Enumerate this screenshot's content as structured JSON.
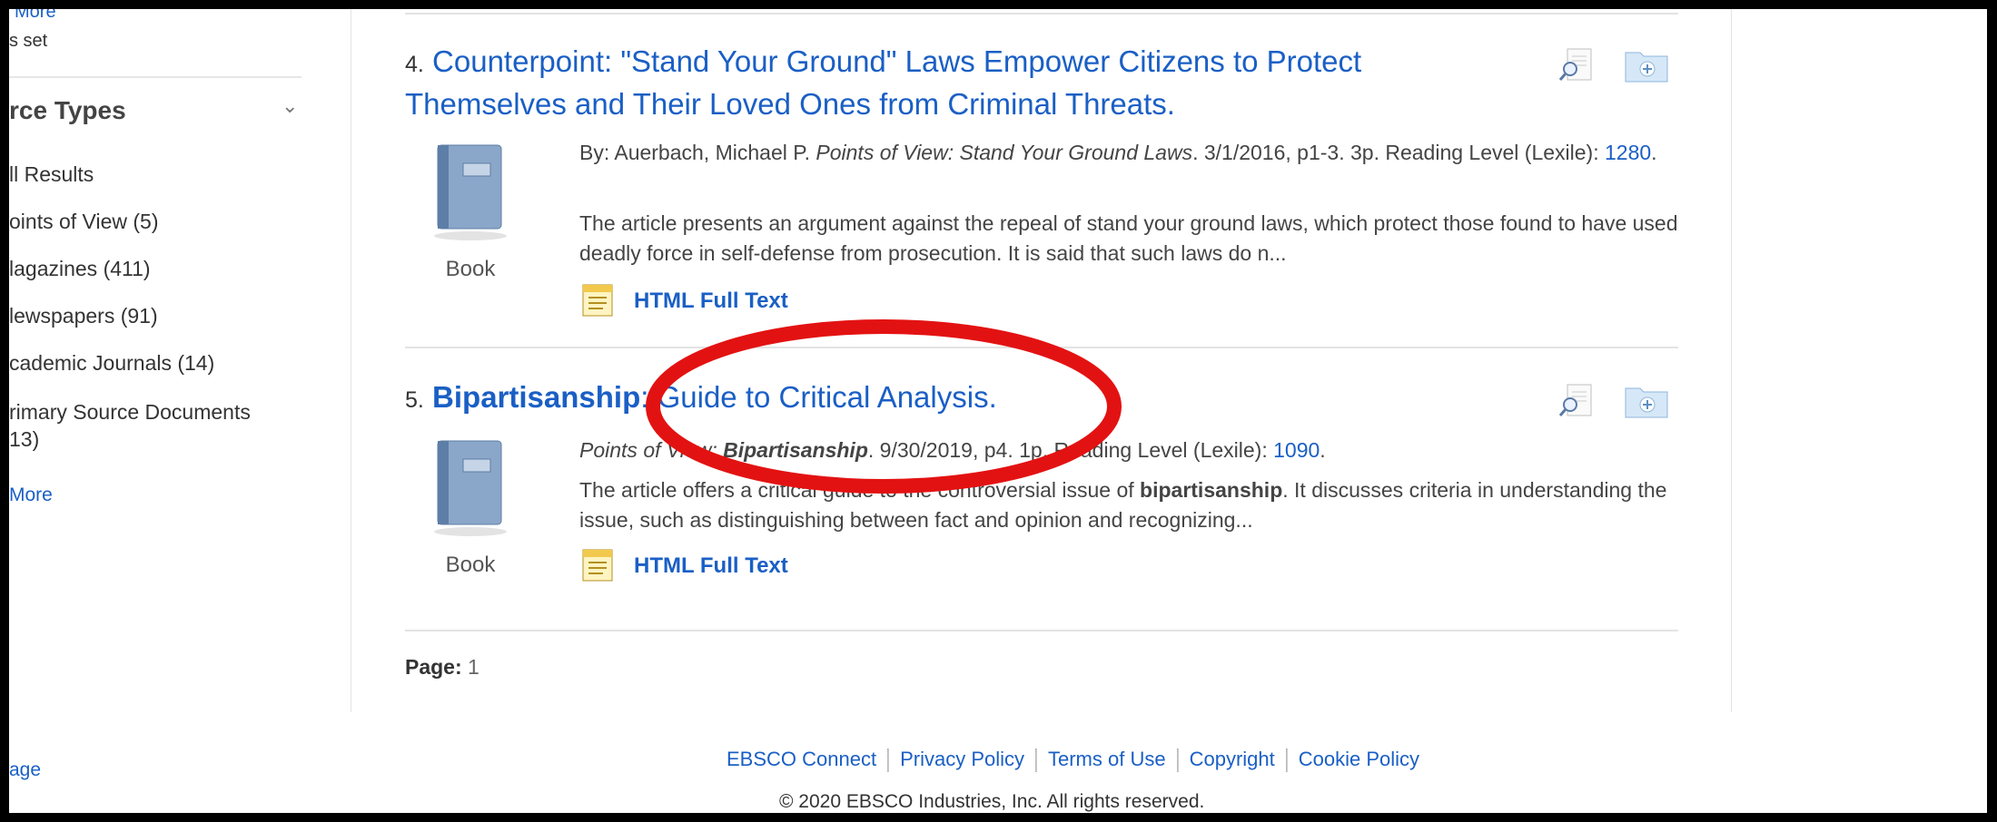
{
  "sidebar": {
    "more_top": "More",
    "set_text": "s set",
    "facet_title": "rce Types",
    "facets": [
      {
        "label": "ll Results"
      },
      {
        "label": "oints of View (5)"
      },
      {
        "label": "lagazines (411)"
      },
      {
        "label": "lewspapers (91)"
      },
      {
        "label": "cademic Journals (14)"
      },
      {
        "label": "rimary Source Documents"
      },
      {
        "label": "13)"
      }
    ],
    "more_bottom": "More",
    "page_link": "age"
  },
  "records": [
    {
      "number": "4.",
      "title": "Counterpoint: \"Stand Your Ground\" Laws Empower Citizens to Protect Themselves and Their Loved Ones from Criminal Threats.",
      "meta_prefix": "By: Auerbach, Michael P. ",
      "meta_source": "Points of View: Stand Your Ground Laws",
      "meta_rest": ". 3/1/2016, p1-3. 3p. Reading Level (Lexile): ",
      "lexile": "1280",
      "meta_end": ".",
      "abstract": "The article presents an argument against the repeal of stand your ground laws, which protect those found to have used deadly force in self-defense from prosecution. It is said that such laws do n...",
      "type_label": "Book",
      "fulltext_label": "HTML Full Text"
    },
    {
      "number": "5.",
      "title_bold": "Bipartisanship",
      "title_rest": ": Guide to Critical Analysis.",
      "meta_source_a": "Points of View: ",
      "meta_source_b": "Bipartisanship",
      "meta_rest": ". 9/30/2019, p4. 1p. Reading Level (Lexile): ",
      "lexile": "1090",
      "meta_end": ".",
      "abstract_a": "The article offers a critical guide to the controversial issue of ",
      "abstract_b": "bipartisanship",
      "abstract_c": ". It discusses criteria in understanding the issue, such as distinguishing between fact and opinion and recognizing...",
      "type_label": "Book",
      "fulltext_label": "HTML Full Text"
    }
  ],
  "pager": {
    "label": "Page:",
    "value": "1"
  },
  "footer": {
    "links": [
      "EBSCO Connect",
      "Privacy Policy",
      "Terms of Use",
      "Copyright",
      "Cookie Policy"
    ],
    "copyright": "© 2020 EBSCO Industries, Inc. All rights reserved."
  },
  "colors": {
    "link": "#1a5fc5",
    "annotation": "#e31212"
  },
  "icons": [
    "chevron-down-icon",
    "preview-magnifier-icon",
    "add-to-folder-icon",
    "book-icon",
    "html-fulltext-icon"
  ]
}
